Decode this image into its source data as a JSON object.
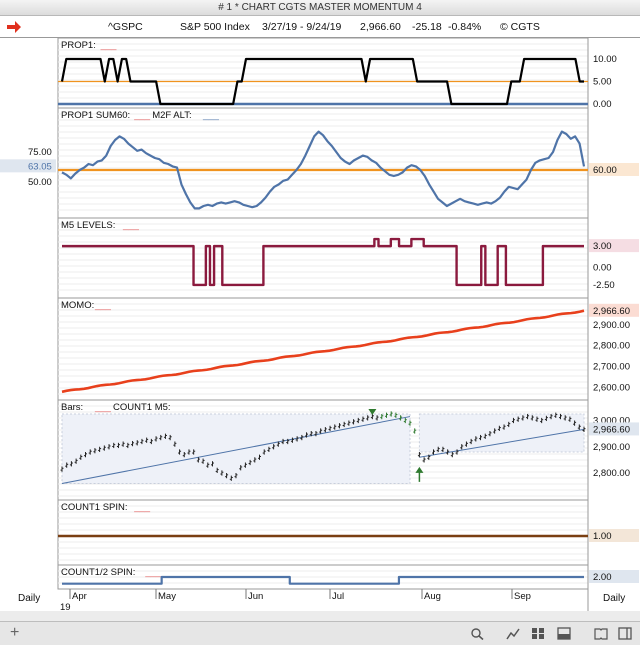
{
  "window": {
    "title": "# 1 * CHART CGTS MASTER MOMENTUM 4"
  },
  "header": {
    "symbol": "^GSPC",
    "name": "S&P 500 Index",
    "range": "3/27/19 - 9/24/19",
    "last": "2,966.60",
    "change": "-25.18",
    "pct": "-0.84%",
    "copyright": "© CGTS"
  },
  "footer": {
    "left_period": "Daily",
    "right_period": "Daily",
    "months": [
      "Apr",
      "May",
      "Jun",
      "Jul",
      "Aug",
      "Sep"
    ],
    "year": "19"
  },
  "icons": [
    "red-arrow-icon",
    "plus-icon",
    "search-icon",
    "line-chart-icon",
    "grid-icon",
    "panel-icon",
    "book-icon",
    "sidebar-icon"
  ],
  "colors": {
    "black": "#000000",
    "blue": "#4f74a8",
    "orange": "#f0931f",
    "maroon": "#8b1a3e",
    "red": "#e8401c",
    "brown": "#7a3f12",
    "green": "#2f7a2f"
  },
  "chart_data": [
    {
      "type": "line",
      "title": "PROP1:",
      "legend_swatch": "___",
      "ticks": [
        "10.00",
        "5.00",
        "0.00"
      ],
      "ylim": [
        0,
        12
      ],
      "refs": [
        {
          "value": 5,
          "color": "#f0931f"
        },
        {
          "value": 0,
          "color": "#4f74a8"
        }
      ],
      "values": [
        5,
        10,
        10,
        10,
        10,
        10,
        10,
        10,
        10,
        10,
        5,
        10,
        10,
        5,
        10,
        10,
        5,
        5,
        5,
        5,
        5,
        5,
        5,
        0,
        0,
        0,
        0,
        0,
        0,
        0,
        0,
        0,
        0,
        0,
        0,
        0,
        0,
        0,
        0,
        0,
        0,
        5,
        5,
        10,
        10,
        10,
        10,
        10,
        10,
        10,
        10,
        10,
        10,
        10,
        10,
        10,
        10,
        10,
        10,
        10,
        10,
        10,
        10,
        10,
        10,
        10,
        10,
        10,
        10,
        10,
        10,
        5,
        10,
        10,
        10,
        10,
        10,
        10,
        10,
        10,
        10,
        10,
        10,
        5,
        5,
        5,
        5,
        5,
        5,
        5,
        5,
        0,
        0,
        0,
        0,
        0,
        0,
        0,
        0,
        0,
        0,
        0,
        0,
        0,
        0,
        5,
        5,
        5,
        10,
        10,
        10,
        10,
        10,
        10,
        10,
        10,
        10,
        10,
        10,
        10,
        10,
        5,
        5
      ],
      "value_label": ""
    },
    {
      "type": "line",
      "title": "PROP1 SUM60:",
      "title2": "M2F ALT:",
      "legend_swatch": "___",
      "legend_swatch2": "___",
      "ticks": [
        "75.00",
        "50.00"
      ],
      "ylim": [
        25,
        100
      ],
      "refs": [
        {
          "value": 60,
          "color": "#f0931f"
        }
      ],
      "ref_label": "60.00",
      "value_label": "63.05",
      "values": [
        58,
        56,
        53,
        57,
        60,
        62,
        65,
        64,
        67,
        68,
        72,
        80,
        85,
        88,
        86,
        82,
        79,
        76,
        77,
        74,
        72,
        70,
        69,
        66,
        65,
        63,
        62,
        48,
        40,
        33,
        28,
        28,
        30,
        31,
        30,
        32,
        33,
        32,
        33,
        34,
        33,
        31,
        30,
        29,
        30,
        33,
        37,
        42,
        46,
        48,
        51,
        52,
        56,
        60,
        65,
        72,
        80,
        88,
        92,
        89,
        84,
        80,
        75,
        70,
        67,
        65,
        68,
        70,
        72,
        71,
        68,
        66,
        62,
        59,
        56,
        55,
        56,
        58,
        62,
        64,
        63,
        60,
        55,
        48,
        42,
        36,
        33,
        30,
        32,
        34,
        36,
        34,
        33,
        32,
        31,
        32,
        33,
        32,
        34,
        37,
        42,
        46,
        45,
        44,
        48,
        52,
        60,
        66,
        68,
        69,
        70,
        75,
        85,
        92,
        90,
        86,
        88,
        82,
        63
      ]
    },
    {
      "type": "line",
      "title": "M5 LEVELS:",
      "legend_swatch": "___",
      "ticks": [
        "3.00",
        "0.00",
        "-2.50"
      ],
      "ylim": [
        -3.5,
        5
      ],
      "value_label": "3.00",
      "values": [
        3,
        3,
        3,
        3,
        3,
        3,
        3,
        3,
        3,
        3,
        3,
        3,
        3,
        3,
        3,
        3,
        3,
        3,
        3,
        3,
        3,
        3,
        3,
        3,
        3,
        3,
        3,
        3,
        3,
        3,
        3,
        3,
        -2.5,
        -2.5,
        -2.5,
        3,
        -2.5,
        3,
        3,
        -2.5,
        -2.5,
        -2.5,
        -2.5,
        -2.5,
        -2.5,
        -2.5,
        -2.5,
        -2.5,
        -2.5,
        3,
        3,
        3,
        3,
        3,
        3,
        3,
        3,
        3,
        3,
        3,
        3,
        3,
        3,
        3,
        3,
        3,
        3,
        3,
        3,
        3,
        3,
        3,
        3,
        3,
        3,
        3,
        4,
        3,
        3,
        3,
        4,
        4,
        3,
        3,
        3,
        4,
        4,
        4,
        3,
        3,
        3,
        3,
        3,
        3,
        3,
        3,
        -2.5,
        -2.5,
        -2.5,
        -2.5,
        -2.5,
        -2.5,
        3,
        -2.5,
        -2.5,
        -2.5,
        3,
        3,
        -2.5,
        -2.5,
        -2.5,
        -2.5,
        -2.5,
        -2.5,
        -2.5,
        -2.5,
        -2.5,
        3,
        3,
        3,
        3,
        3,
        3,
        3,
        3,
        3,
        3,
        3
      ]
    },
    {
      "type": "line",
      "title": "MOMO:",
      "legend_swatch": "___",
      "ticks": [
        "2,900.00",
        "2,800.00",
        "2,700.00",
        "2,600.00"
      ],
      "ylim": [
        2560,
        2980
      ],
      "value_label": "2,966.60",
      "start": 2580,
      "end": 2966.6
    },
    {
      "type": "line",
      "title": "Bars:",
      "title2": "COUNT1 M5:",
      "legend_swatch": "___",
      "ticks": [
        "3,000.00",
        "2,900.00",
        "2,800.00"
      ],
      "ylim": [
        2720,
        3040
      ],
      "value_label": "2,966.60",
      "series": [
        {
          "name": "price",
          "values": [
            2815,
            2830,
            2835,
            2845,
            2860,
            2870,
            2880,
            2885,
            2890,
            2895,
            2900,
            2905,
            2905,
            2910,
            2905,
            2912,
            2915,
            2920,
            2925,
            2920,
            2930,
            2935,
            2940,
            2935,
            2910,
            2880,
            2870,
            2880,
            2880,
            2850,
            2845,
            2830,
            2835,
            2810,
            2800,
            2790,
            2780,
            2790,
            2820,
            2830,
            2840,
            2850,
            2860,
            2880,
            2890,
            2900,
            2910,
            2920,
            2920,
            2925,
            2930,
            2935,
            2945,
            2950,
            2950,
            2960,
            2965,
            2970,
            2975,
            2980,
            2985,
            2990,
            2995,
            3000,
            3005,
            3010,
            3015,
            3010,
            3015,
            3020,
            3025,
            3020,
            3010,
            3000,
            2990,
            2960,
            2870,
            2850,
            2860,
            2880,
            2890,
            2890,
            2880,
            2870,
            2880,
            2900,
            2910,
            2920,
            2930,
            2935,
            2940,
            2950,
            2960,
            2970,
            2975,
            2985,
            3000,
            3005,
            3010,
            3015,
            3010,
            3005,
            3000,
            3008,
            3015,
            3020,
            3015,
            3010,
            3005,
            2990,
            2975,
            2966
          ]
        },
        {
          "name": "count",
          "values": [
            2760,
            2966
          ]
        }
      ]
    },
    {
      "type": "line",
      "title": "COUNT1 SPIN:",
      "legend_swatch": "___",
      "value_label": "1.00",
      "values": [
        1
      ]
    },
    {
      "type": "line",
      "title": "COUNT1/2 SPIN:",
      "legend_swatch": "___",
      "value_label": "2.00",
      "values": [
        1,
        1,
        1,
        1,
        1,
        1,
        1,
        1,
        1,
        1,
        1,
        1,
        1,
        1,
        1,
        1,
        1,
        1,
        1,
        1,
        1,
        2,
        2,
        2,
        2,
        2,
        2,
        2,
        2,
        2,
        2,
        2,
        2,
        2,
        2,
        2,
        2,
        2,
        2,
        2,
        2,
        2,
        2,
        2,
        2,
        2,
        2,
        2,
        1,
        1,
        1,
        1,
        1,
        1,
        1,
        1,
        1,
        1,
        1,
        1,
        1,
        1,
        1,
        1,
        1,
        1,
        1,
        1,
        1,
        1,
        1,
        2,
        2,
        2,
        2,
        2,
        2,
        2,
        2,
        2,
        2,
        2,
        2,
        2,
        2,
        2,
        2,
        2,
        2,
        2,
        2,
        2,
        2,
        2,
        2,
        2,
        2,
        2,
        2,
        2,
        2,
        2,
        2,
        2,
        2,
        2,
        2,
        2,
        2,
        2,
        2
      ]
    }
  ]
}
